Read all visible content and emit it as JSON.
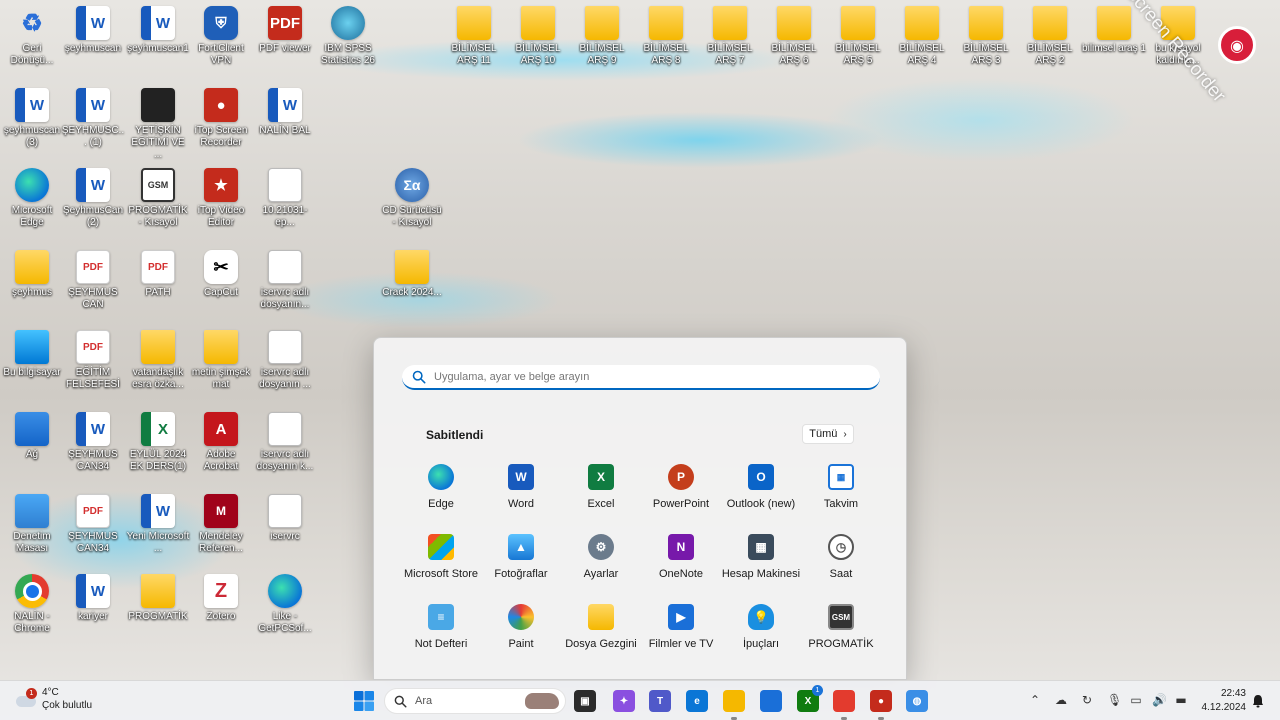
{
  "desktop_icons": [
    {
      "label": "Geri Dönüşü...",
      "glyph": "♻",
      "icon": "recycle-bin-icon",
      "cls": "g-recycle"
    },
    {
      "label": "şeyhmuscan",
      "glyph": "W",
      "icon": "word-document-icon",
      "cls": "g-word"
    },
    {
      "label": "şeyhmuscan1",
      "glyph": "W",
      "icon": "word-document-icon",
      "cls": "g-word"
    },
    {
      "label": "FortiClient VPN",
      "glyph": "⛨",
      "icon": "forticlient-icon",
      "cls": "g-shield"
    },
    {
      "label": "PDF viewer",
      "glyph": "PDF",
      "icon": "pdf-viewer-icon",
      "cls": "g-red"
    },
    {
      "label": "IBM SPSS Statistics 26",
      "glyph": "",
      "icon": "spss-icon",
      "cls": "g-spss"
    },
    {
      "label": "şeyhmuscan (3)",
      "glyph": "W",
      "icon": "word-document-icon",
      "cls": "g-word"
    },
    {
      "label": "ŞEYHMUSC... (1)",
      "glyph": "W",
      "icon": "word-document-icon",
      "cls": "g-word"
    },
    {
      "label": "YETİŞKİN EĞİTİMİ VE ...",
      "glyph": "",
      "icon": "pdf-thumbnail-icon",
      "cls": "g-dark"
    },
    {
      "label": "iTop Screen Recorder",
      "glyph": "●",
      "icon": "itop-screen-recorder-icon",
      "cls": "g-red"
    },
    {
      "label": "NALİN BAL",
      "glyph": "W",
      "icon": "word-document-icon",
      "cls": "g-word"
    },
    {
      "label": "Microsoft Edge",
      "glyph": "",
      "icon": "edge-icon",
      "cls": "g-edge"
    },
    {
      "label": "ŞeyhmusCan (2)",
      "glyph": "W",
      "icon": "word-document-icon",
      "cls": "g-word"
    },
    {
      "label": "PROGMATİK - Kısayol",
      "glyph": "GSM",
      "icon": "progmatik-icon",
      "cls": "g-gsm"
    },
    {
      "label": "iTop Video Editor",
      "glyph": "★",
      "icon": "itop-video-editor-icon",
      "cls": "g-red"
    },
    {
      "label": "10.21031-ep...",
      "glyph": "",
      "icon": "pdf-document-icon",
      "cls": "g-file"
    },
    {
      "label": "CD Sürücüsü - Kısayol",
      "glyph": "Σα",
      "icon": "cd-drive-icon",
      "cls": "g-math"
    },
    {
      "label": "şeyhmus",
      "glyph": "",
      "icon": "user-folder-icon",
      "cls": "g-user"
    },
    {
      "label": "ŞEYHMUS CAN",
      "glyph": "PDF",
      "icon": "pdf-document-icon",
      "cls": "g-pdf"
    },
    {
      "label": "PATH",
      "glyph": "PDF",
      "icon": "pdf-document-icon",
      "cls": "g-pdf"
    },
    {
      "label": "CapCut",
      "glyph": "✂",
      "icon": "capcut-icon",
      "cls": "g-capcut"
    },
    {
      "label": "iservrc adlı dosyanın...",
      "glyph": "",
      "icon": "file-icon",
      "cls": "g-file"
    },
    {
      "label": "Crack 2024...",
      "glyph": "",
      "icon": "folder-icon",
      "cls": "g-folder"
    },
    {
      "label": "Bu bilgisayar",
      "glyph": "",
      "icon": "this-pc-icon",
      "cls": "g-pc"
    },
    {
      "label": "EĞİTİM FELSEFESİ",
      "glyph": "PDF",
      "icon": "pdf-document-icon",
      "cls": "g-pdf"
    },
    {
      "label": "vatandaşlık esra özka...",
      "glyph": "",
      "icon": "folder-icon",
      "cls": "g-folder"
    },
    {
      "label": "metin şimşek mat",
      "glyph": "",
      "icon": "folder-icon",
      "cls": "g-folder"
    },
    {
      "label": "iservrc adlı dosyanın ...",
      "glyph": "",
      "icon": "file-icon",
      "cls": "g-file"
    },
    {
      "label": "Ağ",
      "glyph": "",
      "icon": "network-icon",
      "cls": "g-net"
    },
    {
      "label": "ŞEYHMUS CAN34",
      "glyph": "W",
      "icon": "word-document-icon",
      "cls": "g-word"
    },
    {
      "label": "EYLÜL 2024 EK DERS(1)",
      "glyph": "X",
      "icon": "excel-document-icon",
      "cls": "g-excel"
    },
    {
      "label": "Adobe Acrobat",
      "glyph": "A",
      "icon": "adobe-acrobat-icon",
      "cls": "g-acrobat"
    },
    {
      "label": "iservrc adlı dosyanın k...",
      "glyph": "",
      "icon": "file-icon",
      "cls": "g-file"
    },
    {
      "label": "Denetim Masası",
      "glyph": "",
      "icon": "control-panel-icon",
      "cls": "g-control"
    },
    {
      "label": "ŞEYHMUS CAN34",
      "glyph": "PDF",
      "icon": "pdf-document-icon",
      "cls": "g-pdf"
    },
    {
      "label": "Yeni Microsoft ...",
      "glyph": "W",
      "icon": "word-document-icon",
      "cls": "g-word"
    },
    {
      "label": "Mendeley Referen...",
      "glyph": "M",
      "icon": "mendeley-icon",
      "cls": "g-mendeley"
    },
    {
      "label": "iservrc",
      "glyph": "",
      "icon": "file-icon",
      "cls": "g-file"
    },
    {
      "label": "NALİN - Chrome",
      "glyph": "",
      "icon": "chrome-icon",
      "cls": "g-chrome"
    },
    {
      "label": "kariyer",
      "glyph": "W",
      "icon": "word-document-icon",
      "cls": "g-word"
    },
    {
      "label": "PROGMATİK",
      "glyph": "",
      "icon": "folder-icon",
      "cls": "g-folder"
    },
    {
      "label": "Zotero",
      "glyph": "Z",
      "icon": "zotero-icon",
      "cls": "g-zotero"
    },
    {
      "label": "Like - GetPCSof...",
      "glyph": "",
      "icon": "edge-icon",
      "cls": "g-edge"
    }
  ],
  "top_folders": [
    {
      "label": "BİLİMSEL ARŞ 11"
    },
    {
      "label": "BİLİMSEL ARŞ 10"
    },
    {
      "label": "BİLİMSEL ARŞ 9"
    },
    {
      "label": "BİLİMSEL ARŞ 8"
    },
    {
      "label": "BİLİMSEL ARŞ 7"
    },
    {
      "label": "BİLİMSEL ARŞ 6"
    },
    {
      "label": "BİLİMSEL ARŞ 5"
    },
    {
      "label": "BİLİMSEL ARŞ 4"
    },
    {
      "label": "BİLİMSEL ARŞ 3"
    },
    {
      "label": "BİLİMSEL ARŞ 2"
    },
    {
      "label": "bilimsel araş 1"
    },
    {
      "label": "bu kısayol kaldırıla..."
    }
  ],
  "watermark": "iTop Screen Recorder",
  "start_menu": {
    "search_placeholder": "Uygulama, ayar ve belge arayın",
    "pinned_title": "Sabitlendi",
    "all_button": "Tümü",
    "apps": [
      {
        "label": "Edge",
        "glyph": "",
        "icon": "edge-icon",
        "cls": "ai-edge"
      },
      {
        "label": "Word",
        "glyph": "W",
        "icon": "word-icon",
        "cls": "ai-word"
      },
      {
        "label": "Excel",
        "glyph": "X",
        "icon": "excel-icon",
        "cls": "ai-excel"
      },
      {
        "label": "PowerPoint",
        "glyph": "P",
        "icon": "powerpoint-icon",
        "cls": "ai-ppt"
      },
      {
        "label": "Outlook (new)",
        "glyph": "O",
        "icon": "outlook-icon",
        "cls": "ai-outlook"
      },
      {
        "label": "Takvim",
        "glyph": "▦",
        "icon": "calendar-icon",
        "cls": "ai-cal"
      },
      {
        "label": "Microsoft Store",
        "glyph": "",
        "icon": "store-icon",
        "cls": "ai-store"
      },
      {
        "label": "Fotoğraflar",
        "glyph": "▲",
        "icon": "photos-icon",
        "cls": "ai-photos"
      },
      {
        "label": "Ayarlar",
        "glyph": "⚙",
        "icon": "gear-icon",
        "cls": "ai-settings"
      },
      {
        "label": "OneNote",
        "glyph": "N",
        "icon": "onenote-icon",
        "cls": "ai-onenote"
      },
      {
        "label": "Hesap Makinesi",
        "glyph": "▦",
        "icon": "calculator-icon",
        "cls": "ai-calc"
      },
      {
        "label": "Saat",
        "glyph": "◷",
        "icon": "clock-icon",
        "cls": "ai-clock"
      },
      {
        "label": "Not Defteri",
        "glyph": "≡",
        "icon": "notepad-icon",
        "cls": "ai-notepad"
      },
      {
        "label": "Paint",
        "glyph": "",
        "icon": "paint-icon",
        "cls": "ai-paint"
      },
      {
        "label": "Dosya Gezgini",
        "glyph": "",
        "icon": "file-explorer-icon",
        "cls": "ai-explorer"
      },
      {
        "label": "Filmler ve TV",
        "glyph": "▶",
        "icon": "films-tv-icon",
        "cls": "ai-films"
      },
      {
        "label": "İpuçları",
        "glyph": "💡",
        "icon": "tips-icon",
        "cls": "ai-tips"
      },
      {
        "label": "PROGMATİK",
        "glyph": "GSM",
        "icon": "progmatik-icon",
        "cls": "ai-prog"
      }
    ]
  },
  "taskbar": {
    "weather_temp": "4°C",
    "weather_desc": "Çok bulutlu",
    "weather_badge": "1",
    "search_label": "Ara",
    "apps": [
      {
        "icon": "task-view-icon",
        "glyph": "▣",
        "color": "#2b2b2b"
      },
      {
        "icon": "copilot-icon",
        "glyph": "✦",
        "color": "#8a4fe0"
      },
      {
        "icon": "teams-icon",
        "glyph": "T",
        "color": "#5059c9"
      },
      {
        "icon": "edge-icon",
        "glyph": "e",
        "color": "#0a76d6"
      },
      {
        "icon": "file-explorer-icon",
        "glyph": "",
        "color": "#f5b800"
      },
      {
        "icon": "store-icon",
        "glyph": "",
        "color": "#1a6fd8"
      },
      {
        "icon": "xbox-icon",
        "glyph": "X",
        "color": "#107c10"
      },
      {
        "icon": "chrome-icon",
        "glyph": "",
        "color": "#e33b2e"
      },
      {
        "icon": "itop-screen-recorder-icon",
        "glyph": "●",
        "color": "#c42b1c"
      },
      {
        "icon": "globe-icon",
        "glyph": "◍",
        "color": "#3a8ee6"
      }
    ],
    "xbox_badge": "1",
    "time": "22:43",
    "date": "4.12.2024"
  }
}
